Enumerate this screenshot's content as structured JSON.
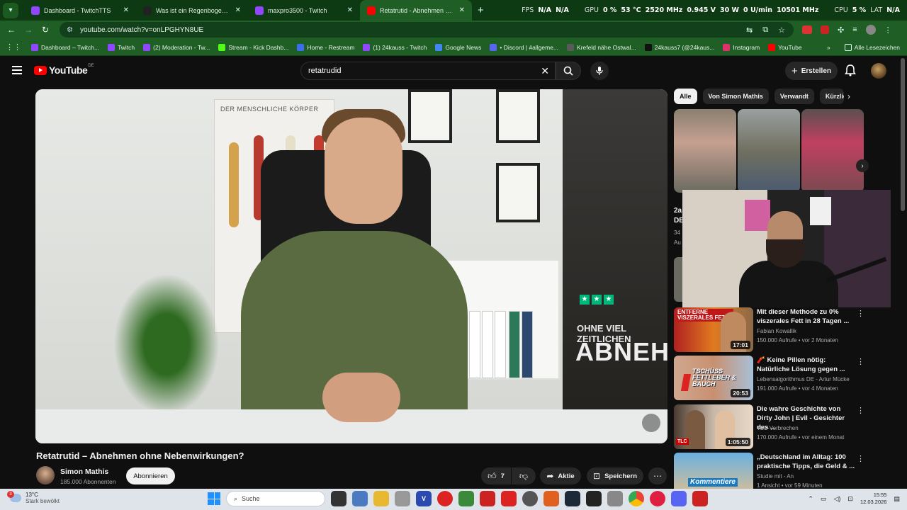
{
  "browser": {
    "tabs": [
      {
        "label": "Dashboard - TwitchTTS",
        "fav": "#9146ff",
        "active": false
      },
      {
        "label": "Was ist ein Regenbogenkind? -",
        "fav": "#222222",
        "active": false
      },
      {
        "label": "maxpro3500 - Twitch",
        "fav": "#9146ff",
        "active": false
      },
      {
        "label": "Retatrutid - Abnehmen ohne N",
        "fav": "#ff0000",
        "active": true
      }
    ],
    "stats": {
      "fps_label": "FPS",
      "fps_val1": "N/A",
      "fps_val2": "N/A",
      "gpu_label": "GPU",
      "gpu_pct": "0 %",
      "gpu_temp": "53 °C",
      "gpu_clock": "2520 MHz",
      "gpu_volt": "0.945 V",
      "gpu_power": "30 W",
      "gpu_fan": "0 U/min",
      "gpu_mem": "10501 MHz",
      "cpu_label": "CPU",
      "cpu_pct": "5 %",
      "lat_label": "LAT",
      "lat_val": "N/A"
    },
    "url": "youtube.com/watch?v=onLPGHYN8UE",
    "bookmarks": [
      {
        "label": "Dashboard – Twitch...",
        "color": "#9146ff"
      },
      {
        "label": "Twitch",
        "color": "#9146ff"
      },
      {
        "label": "(2) Moderation - Tw...",
        "color": "#9146ff"
      },
      {
        "label": "Stream - Kick Dashb...",
        "color": "#53fc18"
      },
      {
        "label": "Home - Restream",
        "color": "#3a6df0"
      },
      {
        "label": "(1) 24kauss - Twitch",
        "color": "#9146ff"
      },
      {
        "label": "Google News",
        "color": "#4285f4"
      },
      {
        "label": "• Discord | #allgeme...",
        "color": "#5865f2"
      },
      {
        "label": "Krefeld nähe Ostwal...",
        "color": "#5a5a5a"
      },
      {
        "label": "24kauss7 (@24kaus...",
        "color": "#111111"
      },
      {
        "label": "Instagram",
        "color": "#e1306c"
      },
      {
        "label": "YouTube",
        "color": "#ff0000"
      }
    ],
    "all_bookmarks": "Alle Lesezeichen"
  },
  "youtube": {
    "logo": "YouTube",
    "country": "DE",
    "search_value": "retatrudid",
    "create_label": "Erstellen",
    "video": {
      "poster_title": "DER MENSCHLICHE KÖRPER",
      "banner_small": "OHNE VIEL ZEITLICHEN",
      "banner_big": "ABNEH",
      "title": "Retatrutid – Abnehmen ohne Nebenwirkungen?",
      "channel": "Simon Mathis",
      "subscribers": "185.000 Abonnenten",
      "subscribe_label": "Abonnieren",
      "likes": "7",
      "share_label": "Aktie",
      "save_label": "Speichern"
    },
    "chips": [
      "Alle",
      "Von Simon Mathis",
      "Verwandt",
      "Kürzlic"
    ],
    "partial_texts": [
      "2a",
      "DE",
      "34",
      "Au"
    ],
    "recommendations": [
      {
        "title": "Mit dieser Methode zu 0% viszerales Fett in 28 Tagen ...",
        "channel": "Fabian Kowallik",
        "meta": "150.000 Aufrufe • vor 2 Monaten",
        "duration": "17:01",
        "thumb_text": "ENTFERNE VISZERALES FETT"
      },
      {
        "title": "🧨 Keine Pillen nötig: Natürliche Lösung gegen ...",
        "channel": "Lebensalgorithmus DE - Artur Mücke",
        "meta": "191.000 Aufrufe • vor 4 Monaten",
        "duration": "20:53",
        "thumb_text": "TSCHÜSS FETTLEBER & BAUCH"
      },
      {
        "title": "Die wahre Geschichte von Dirty John | Evil - Gesichter des ...",
        "channel": "TLC-Verbrechen",
        "meta": "170.000 Aufrufe • vor einem Monat",
        "duration": "1:05:50",
        "thumb_text": "TLC"
      },
      {
        "title": "„Deutschland im Alltag: 100 praktische Tipps, die Geld & ...",
        "channel": "Studie mit - An",
        "meta": "1 Ansicht • vor 59 Minuten",
        "duration": "",
        "thumb_text": "Kommentiere"
      }
    ]
  },
  "taskbar": {
    "temp": "13°C",
    "weather": "Stark bewölkt",
    "badge": "3",
    "search": "Suche",
    "time": "15:55",
    "date": "12.03.2026"
  }
}
